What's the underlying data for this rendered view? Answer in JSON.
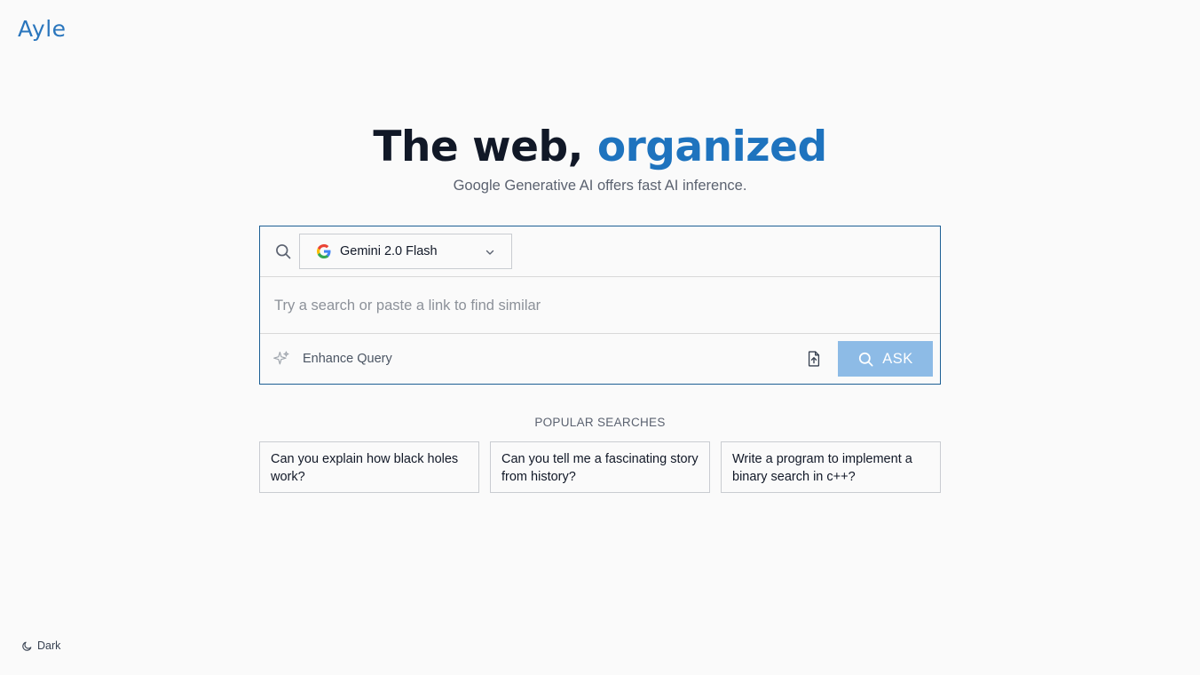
{
  "brand": {
    "logo_text": "Ayle"
  },
  "hero": {
    "title_main": "The web, ",
    "title_accent": "organized",
    "subtitle": "Google Generative AI offers fast AI inference."
  },
  "search": {
    "model": {
      "selected": "Gemini 2.0 Flash",
      "provider_icon": "google-g-icon"
    },
    "placeholder": "Try a search or paste a link to find similar",
    "enhance_label": "Enhance Query",
    "ask_label": "ASK"
  },
  "popular": {
    "title": "POPULAR SEARCHES",
    "items": [
      {
        "text": "Can you explain how black holes work?"
      },
      {
        "text": "Can you tell me a fascinating story from history?"
      },
      {
        "text": "Write a program to implement a binary search in c++?"
      }
    ]
  },
  "theme_toggle": {
    "label": "Dark",
    "icon": "moon-icon"
  },
  "colors": {
    "accent": "#1e73be",
    "ask_button": "#8dbbe6",
    "search_border": "#1d5f94",
    "background": "#fafafa"
  }
}
